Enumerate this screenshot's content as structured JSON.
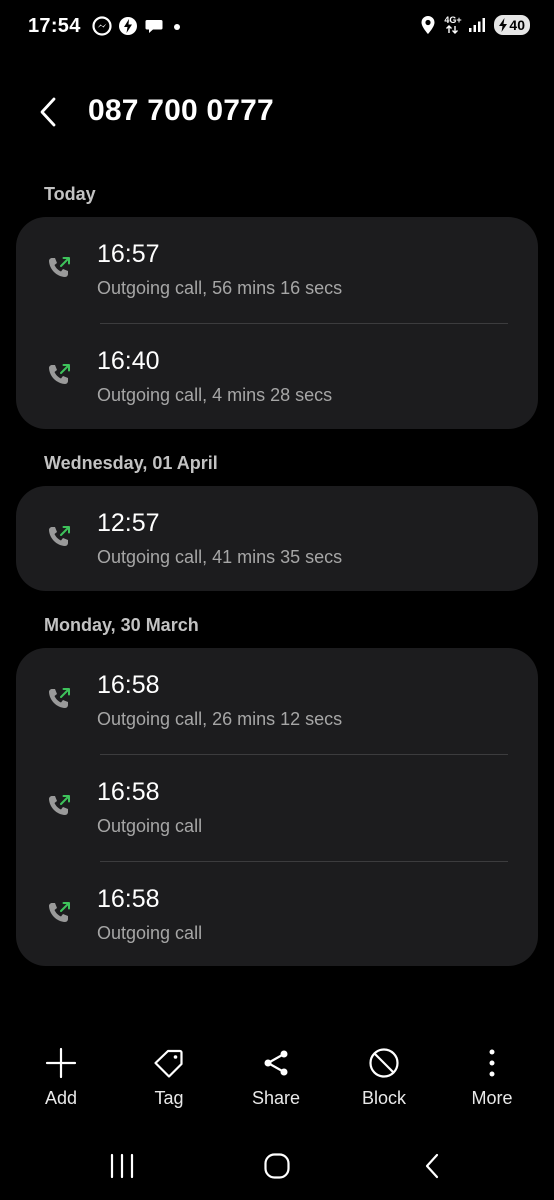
{
  "status_bar": {
    "time": "17:54",
    "network": "4G+",
    "battery": "40"
  },
  "header": {
    "title": "087 700 0777"
  },
  "sections": [
    {
      "label": "Today",
      "calls": [
        {
          "time": "16:57",
          "description": "Outgoing call, 56 mins 16 secs"
        },
        {
          "time": "16:40",
          "description": "Outgoing call, 4 mins 28 secs"
        }
      ]
    },
    {
      "label": "Wednesday, 01 April",
      "calls": [
        {
          "time": "12:57",
          "description": "Outgoing call, 41 mins 35 secs"
        }
      ]
    },
    {
      "label": "Monday, 30 March",
      "calls": [
        {
          "time": "16:58",
          "description": "Outgoing call, 26 mins 12 secs"
        },
        {
          "time": "16:58",
          "description": "Outgoing call"
        },
        {
          "time": "16:58",
          "description": "Outgoing call"
        }
      ]
    }
  ],
  "toolbar": {
    "add_label": "Add",
    "tag_label": "Tag",
    "share_label": "Share",
    "block_label": "Block",
    "more_label": "More"
  },
  "colors": {
    "background": "#000000",
    "card": "#1c1c1e",
    "outgoing_arrow": "#3ec35b",
    "secondary_text": "#a6a6a6"
  },
  "icons": {
    "call_icon": "outgoing-call-icon",
    "back_icon": "chevron-left-icon"
  }
}
